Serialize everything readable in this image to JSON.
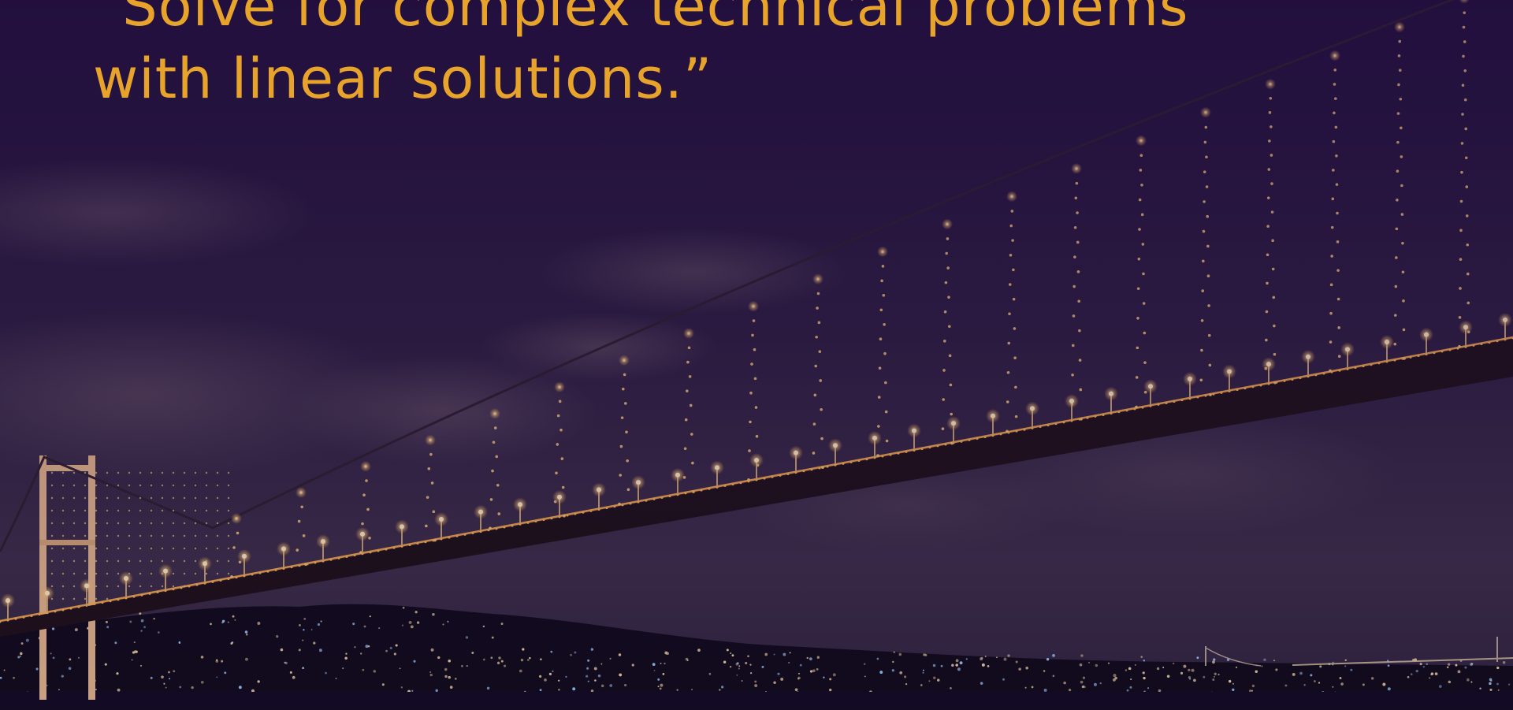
{
  "quote": {
    "line_1": "“Solve for complex technical problems",
    "line_2": "with linear solutions.”"
  },
  "colors": {
    "quote_text": "#e8a32a",
    "sky_top": "#1e0f38",
    "sky_bottom": "#4a3a48",
    "bridge_lights": "#ffd27a",
    "water": "#0f0a1e"
  },
  "scene": {
    "subject": "illuminated-suspension-bridge-at-night",
    "overlay_tint": "purple"
  }
}
